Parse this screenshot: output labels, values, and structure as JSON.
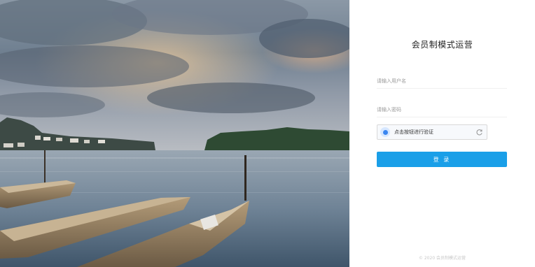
{
  "login": {
    "title": "会员制模式运营",
    "username_placeholder": "请输入用户名",
    "password_placeholder": "请输入密码",
    "captcha_label": "点击按钮进行验证",
    "submit_label": "登 录"
  },
  "footer": {
    "text": "© 2020 会员制模式运营"
  },
  "icons": {
    "captcha": "radio-dot-icon",
    "refresh": "refresh-icon"
  },
  "colors": {
    "accent": "#1a9fe8",
    "captcha_dot": "#3a86f0"
  }
}
